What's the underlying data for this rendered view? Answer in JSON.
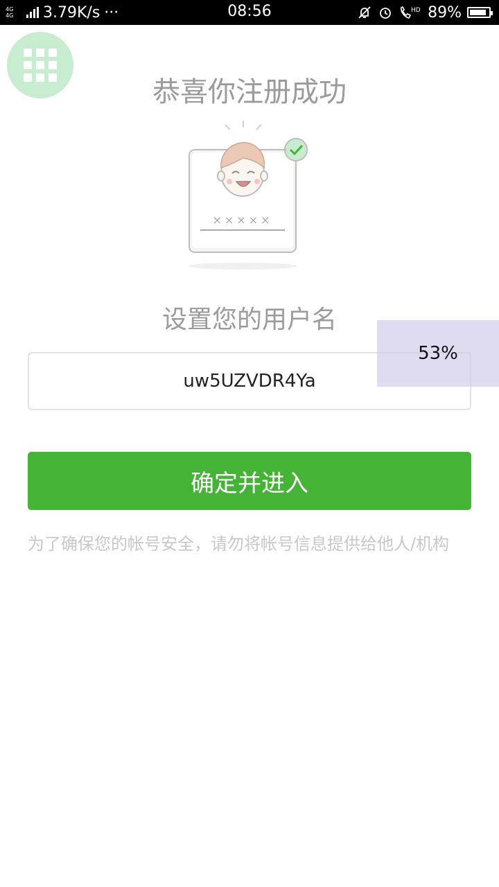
{
  "status_bar": {
    "network": "4G 4G",
    "speed": "3.79K/s",
    "more": "···",
    "time": "08:56",
    "hd_label": "HD",
    "battery": "89%",
    "battery_level": 0.89
  },
  "page": {
    "title": "恭喜你注册成功",
    "subtitle": "设置您的用户名",
    "illustration_password_mask": "×××××"
  },
  "username_input": {
    "value": "uw5UZVDR4Ya"
  },
  "overlay": {
    "label": "53%"
  },
  "confirm_button": {
    "label": "确定并进入"
  },
  "notice": {
    "text": "为了确保您的帐号安全，请勿将帐号信息提供给他人/机构"
  },
  "colors": {
    "primary_green": "#45b336",
    "grid_button_bg": "#c8ecd0",
    "title_gray": "#9b9b9b",
    "notice_gray": "#c8c8c8",
    "overlay": "#d2cdeb"
  },
  "icons": {
    "grid_button": "grid-icon",
    "illustration": "registration-success-illustration"
  }
}
